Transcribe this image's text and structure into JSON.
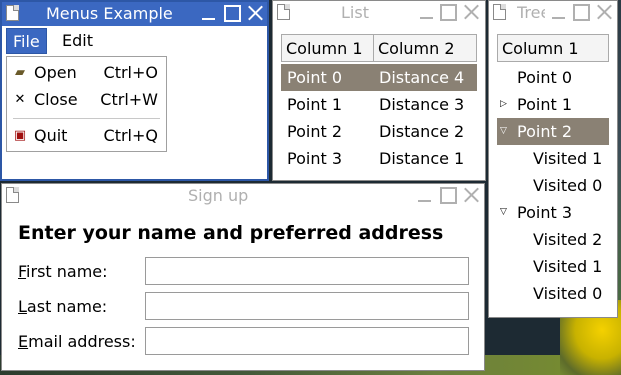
{
  "menus_window": {
    "title": "Menus Example",
    "menubar": [
      "File",
      "Edit"
    ],
    "file_menu": [
      {
        "icon": "open-folder-icon",
        "label": "Open",
        "accel": "Ctrl+O"
      },
      {
        "icon": "close-x-icon",
        "label": "Close",
        "accel": "Ctrl+W"
      },
      {
        "icon": "quit-door-icon",
        "label": "Quit",
        "accel": "Ctrl+Q"
      }
    ]
  },
  "list_window": {
    "title": "List",
    "columns": [
      "Column 1",
      "Column 2"
    ],
    "rows": [
      [
        "Point 0",
        "Distance 4"
      ],
      [
        "Point 1",
        "Distance 3"
      ],
      [
        "Point 2",
        "Distance 2"
      ],
      [
        "Point 3",
        "Distance 1"
      ]
    ],
    "selected_row": 0
  },
  "tree_window": {
    "title": "Tree",
    "column": "Column 1",
    "nodes": [
      {
        "label": "Point 0"
      },
      {
        "label": "Point 1"
      },
      {
        "label": "Point 2"
      },
      {
        "label": "Visited 1"
      },
      {
        "label": "Visited 0"
      },
      {
        "label": "Point 3"
      },
      {
        "label": "Visited 2"
      },
      {
        "label": "Visited 1"
      },
      {
        "label": "Visited 0"
      }
    ]
  },
  "signup_window": {
    "title": "Sign up",
    "heading": "Enter your name and preferred address",
    "fields": [
      {
        "label": "First name:",
        "mnemonic": "F",
        "value": ""
      },
      {
        "label": "Last name:",
        "mnemonic": "L",
        "value": ""
      },
      {
        "label": "Email address:",
        "mnemonic": "E",
        "value": ""
      }
    ]
  },
  "colors": {
    "active_title": "#3b68c1",
    "selection": "#8a8174"
  }
}
